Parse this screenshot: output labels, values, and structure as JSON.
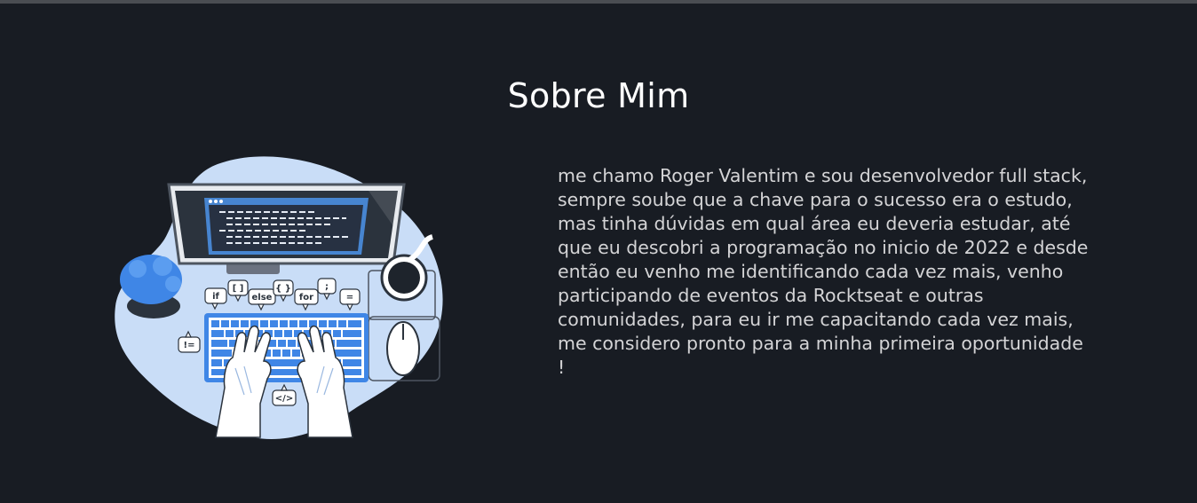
{
  "section": {
    "title": "Sobre Mim",
    "body": "me chamo Roger Valentim e sou desenvolvedor full stack, sempre soube que a chave para o sucesso era o estudo, mas tinha dúvidas em qual área eu deveria estudar, até que eu descobri a programação no inicio de 2022 e desde então eu venho me identificando cada vez mais, venho participando de eventos da Rocktseat e outras comunidades, para eu ir me capacitando cada vez mais, me considero pronto para a minha primeira oportunidade !"
  },
  "illustration": {
    "icon": "developer-at-desk-illustration",
    "code_bubbles": [
      "if",
      "[ ]",
      "else",
      "{ }",
      "for",
      ";",
      "=",
      "!=",
      "</>"
    ],
    "colors": {
      "blob": "#c9ddf7",
      "screen": "#2b333d",
      "code_window": "#4a8ee0",
      "accent_blue": "#3f86e6",
      "background": "#181c23"
    }
  }
}
